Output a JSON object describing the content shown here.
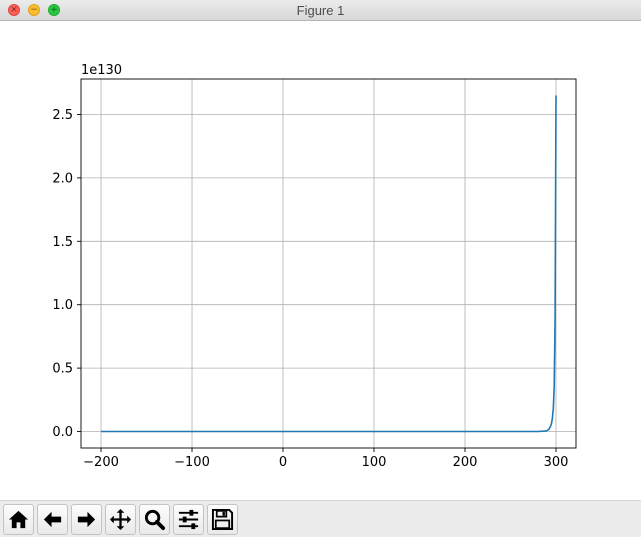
{
  "window": {
    "title": "Figure 1",
    "controls": [
      "close",
      "minimize",
      "zoom"
    ]
  },
  "toolbar": {
    "buttons": [
      {
        "name": "home-icon"
      },
      {
        "name": "back-arrow-icon"
      },
      {
        "name": "forward-arrow-icon"
      },
      {
        "name": "pan-icon"
      },
      {
        "name": "zoom-magnifier-icon"
      },
      {
        "name": "configure-subplots-icon"
      },
      {
        "name": "save-floppy-icon"
      }
    ]
  },
  "chart_data": {
    "type": "line",
    "title": "",
    "xlabel": "",
    "ylabel": "",
    "y_offset_text": "1e130",
    "xlim": [
      -222,
      322
    ],
    "ylim": [
      -0.13,
      2.78
    ],
    "xticks": [
      -200,
      -100,
      0,
      100,
      200,
      300
    ],
    "xtick_labels": [
      "−200",
      "−100",
      "0",
      "100",
      "200",
      "300"
    ],
    "yticks": [
      0.0,
      0.5,
      1.0,
      1.5,
      2.0,
      2.5
    ],
    "ytick_labels": [
      "0.0",
      "0.5",
      "1.0",
      "1.5",
      "2.0",
      "2.5"
    ],
    "grid": true,
    "series": [
      {
        "color": "#1f77b4",
        "x": [
          -200,
          -100,
          0,
          100,
          200,
          280,
          288,
          290,
          292,
          294,
          295,
          296,
          297,
          298,
          299,
          300
        ],
        "y": [
          0,
          0,
          0,
          0,
          0,
          0,
          0.003,
          0.007,
          0.015,
          0.04,
          0.06,
          0.1,
          0.18,
          0.35,
          0.9,
          2.65
        ]
      }
    ]
  }
}
